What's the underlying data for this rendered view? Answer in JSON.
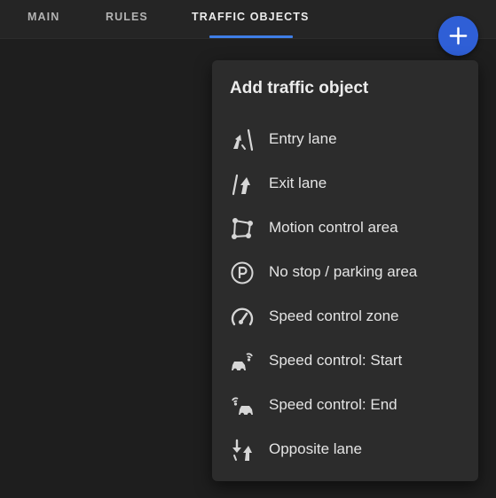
{
  "tabs": [
    {
      "label": "MAIN",
      "active": false
    },
    {
      "label": "RULES",
      "active": false
    },
    {
      "label": "TRAFFIC OBJECTS",
      "active": true
    }
  ],
  "fab": {
    "icon": "plus-icon"
  },
  "menu": {
    "title": "Add traffic object",
    "items": [
      {
        "label": "Entry lane",
        "icon": "entry-lane-icon"
      },
      {
        "label": "Exit lane",
        "icon": "exit-lane-icon"
      },
      {
        "label": "Motion control area",
        "icon": "polygon-area-icon"
      },
      {
        "label": "No stop / parking area",
        "icon": "parking-icon"
      },
      {
        "label": "Speed control zone",
        "icon": "speedometer-icon"
      },
      {
        "label": "Speed control: Start",
        "icon": "speed-camera-start-icon"
      },
      {
        "label": "Speed control: End",
        "icon": "speed-camera-end-icon"
      },
      {
        "label": "Opposite lane",
        "icon": "opposite-lane-icon"
      }
    ]
  },
  "colors": {
    "background": "#1e1e1e",
    "topbar": "#252525",
    "menu": "#2c2c2c",
    "accent": "#2f5fd6",
    "tab_underline": "#3f7ee6",
    "text": "#e4e4e4"
  }
}
